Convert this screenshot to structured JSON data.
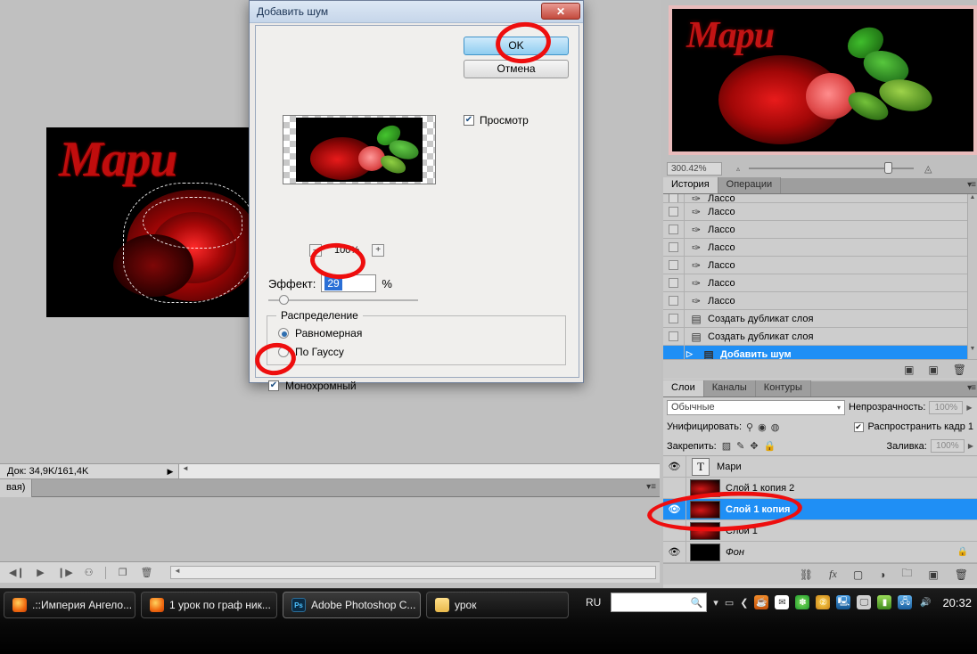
{
  "dialog": {
    "title": "Добавить шум",
    "close_label": "✕",
    "ok_label": "OK",
    "cancel_label": "Отмена",
    "preview_label": "Просмотр",
    "preview_checked": "✔",
    "zoom_minus": "–",
    "zoom_level": "100%",
    "zoom_plus": "+",
    "effect_label": "Эффект:",
    "effect_value": "29",
    "percent_sign": "%",
    "distribution_legend": "Распределение",
    "radio_uniform": "Равномерная",
    "radio_gaussian": "По Гауссу",
    "mono_label": "Монохромный",
    "mono_checked": "✔"
  },
  "canvas": {
    "artwork_text": "Мари"
  },
  "navigator": {
    "zoom_value": "300.42%",
    "artwork_text": "Мари"
  },
  "status": {
    "doc_info": "Док: 34,9K/161,4K",
    "tab_fragment": "вая)",
    "arrow": "▶",
    "scroll_arrow": "◄"
  },
  "animation": {
    "buttons": [
      "◀❙",
      "▶",
      "❙▶",
      "⚇"
    ],
    "sep": "",
    "scroll_arrow": "◄"
  },
  "history": {
    "tabs": [
      {
        "label": "История",
        "active": true
      },
      {
        "label": "Операции",
        "active": false
      }
    ],
    "menu_icon": "▾≡",
    "rows": [
      {
        "label": "Лассо",
        "icon": "lasso-icon",
        "partial": true
      },
      {
        "label": "Лассо",
        "icon": "lasso-icon"
      },
      {
        "label": "Лассо",
        "icon": "lasso-icon"
      },
      {
        "label": "Лассо",
        "icon": "lasso-icon"
      },
      {
        "label": "Лассо",
        "icon": "lasso-icon"
      },
      {
        "label": "Лассо",
        "icon": "lasso-icon"
      },
      {
        "label": "Лассо",
        "icon": "lasso-icon"
      },
      {
        "label": "Создать дубликат слоя",
        "icon": "duplicate-layer-icon"
      },
      {
        "label": "Создать дубликат слоя",
        "icon": "duplicate-layer-icon"
      },
      {
        "label": "Добавить шум",
        "icon": "add-noise-icon",
        "selected": true
      }
    ],
    "footer_icons": [
      "create-document-icon",
      "create-snapshot-icon",
      "delete-icon"
    ],
    "scroll_up": "▲",
    "scroll_down": "▼"
  },
  "layers": {
    "tabs": [
      {
        "label": "Слои",
        "active": true
      },
      {
        "label": "Каналы",
        "active": false
      },
      {
        "label": "Контуры",
        "active": false
      }
    ],
    "menu_icon": "▾≡",
    "blend_mode": "Обычные",
    "opacity_label": "Непрозрачность:",
    "opacity_value": "100%",
    "unify_label": "Унифицировать:",
    "propagate_label": "Распространить кадр 1",
    "propagate_checked": "✔",
    "lock_label": "Закрепить:",
    "fill_label": "Заливка:",
    "fill_value": "100%",
    "rows": [
      {
        "name": "Мари",
        "type": "text",
        "visible": true
      },
      {
        "name": "Слой 1 копия 2",
        "type": "image",
        "visible": false
      },
      {
        "name": "Слой 1 копия",
        "type": "image",
        "visible": true,
        "selected": true
      },
      {
        "name": "Слой 1",
        "type": "image",
        "visible": false
      },
      {
        "name": "Фон",
        "type": "background",
        "visible": true,
        "locked": true
      }
    ],
    "footer_icons": [
      "link-icon",
      "fx-icon",
      "mask-icon",
      "adjustment-icon",
      "group-icon",
      "new-layer-icon",
      "delete-layer-icon"
    ],
    "eye_glyph": "👁"
  },
  "taskbar": {
    "buttons": [
      {
        "label": ".::Империя Ангело...",
        "icon": "firefox-icon",
        "active": false
      },
      {
        "label": "1 урок по граф ник...",
        "icon": "firefox-icon",
        "active": false
      },
      {
        "label": "Adobe Photoshop C...",
        "icon": "photoshop-icon",
        "active": true
      },
      {
        "label": "урок",
        "icon": "folder-icon",
        "active": false
      }
    ],
    "language": "RU",
    "search_placeholder": "",
    "search_icon": "search-icon",
    "tray_chevron": "❮",
    "tray_icons": [
      "java-icon",
      "mail-icon",
      "clover-icon",
      "opera-icon",
      "remote-icon",
      "monitor-icon",
      "battery-icon",
      "network-icon",
      "volume-icon"
    ],
    "clock": "20:32"
  },
  "colors": {
    "selection_blue": "#1f8ff5",
    "annotation_red": "#ee0e0e",
    "dialog_bg": "#f0efed",
    "panel_bg": "#cfcfcf",
    "desktop": "#c0c0c0"
  }
}
